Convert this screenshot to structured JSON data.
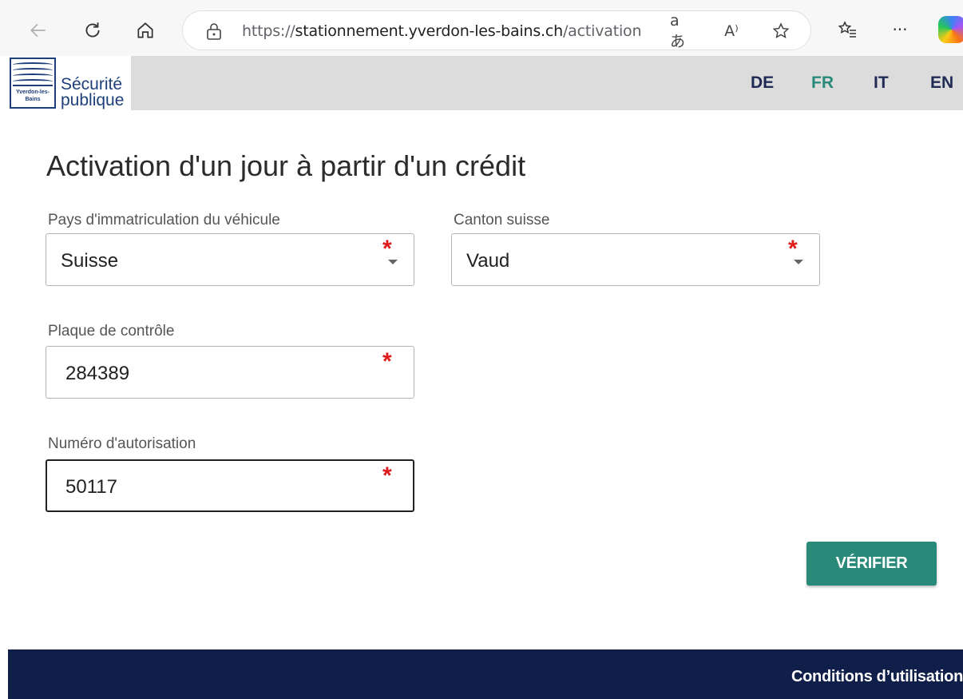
{
  "browser": {
    "url_scheme": "https://",
    "url_host": "stationnement.yverdon-les-bains.ch",
    "url_path": "/activation",
    "translate_glyph": "aあ",
    "read_aloud_glyph": "A⁾",
    "more_glyph": "···"
  },
  "header": {
    "logo_caption": "Yverdon-les-Bains",
    "logo_line1": "Sécurité",
    "logo_line2": "publique",
    "languages": [
      {
        "code": "DE",
        "active": false
      },
      {
        "code": "FR",
        "active": true
      },
      {
        "code": "IT",
        "active": false
      },
      {
        "code": "EN",
        "active": false
      }
    ]
  },
  "form": {
    "title": "Activation d'un jour à partir d'un crédit",
    "required_marker": "*",
    "country": {
      "label": "Pays d'immatriculation du véhicule",
      "value": "Suisse"
    },
    "canton": {
      "label": "Canton suisse",
      "value": "Vaud"
    },
    "plate": {
      "label": "Plaque de contrôle",
      "value": "284389"
    },
    "authorization": {
      "label": "Numéro d'autorisation",
      "value": "50117"
    },
    "verify_label": "VÉRIFIER"
  },
  "footer": {
    "terms_label": "Conditions d’utilisation"
  },
  "colors": {
    "accent": "#2a8a7a",
    "footer_bg": "#0f1f4a",
    "required": "#e01b1b",
    "header_bg": "#dcdcdc"
  }
}
